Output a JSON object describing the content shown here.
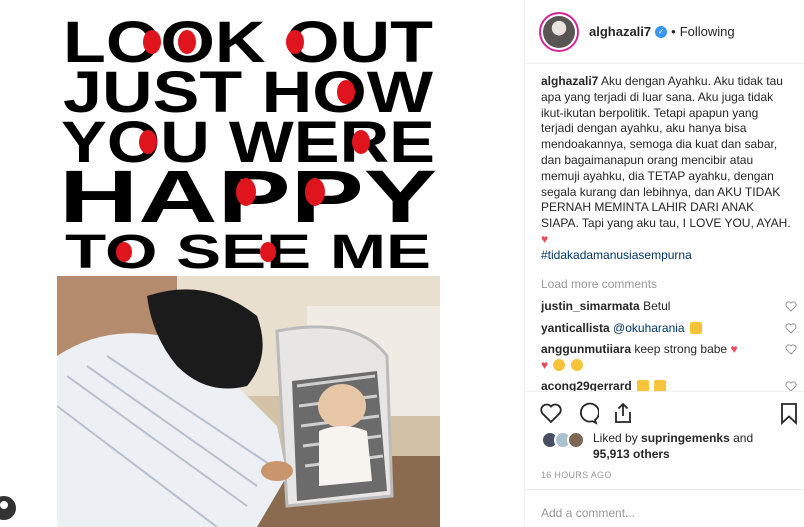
{
  "post_image": {
    "poster_lines": [
      "LOOK OUT",
      "JUST HOW",
      "YOU WERE",
      "HAPPY",
      "TO SEE ME"
    ]
  },
  "header": {
    "username": "alghazali7",
    "separator": "•",
    "follow_status": "Following"
  },
  "caption": {
    "username": "alghazali7",
    "text": "Aku dengan Ayahku. Aku tidak tau apa yang terjadi di luar sana. Aku juga tidak ikut-ikutan berpolitik. Tetapi apapun yang terjadi dengan ayahku, aku hanya bisa mendoakannya, semoga dia kuat dan sabar, dan bagaimanapun orang mencibir atau memuji ayahku, dia TETAP ayahku, dengan segala kurang dan lebihnya, dan AKU TIDAK PERNAH MEMINTA LAHIR DARI ANAK SIAPA. Tapi yang aku tau, I LOVE YOU, AYAH.",
    "emoji": "♥",
    "hashtag": "#tidakadamanusiasempurna"
  },
  "load_more": "Load more comments",
  "comments": [
    {
      "username": "justin_simarmata",
      "text": "Betul"
    },
    {
      "username": "yanticallista",
      "mention": "@okuharania"
    },
    {
      "username": "anggunmutiiara",
      "text": "keep strong babe"
    },
    {
      "username": "acong29gerrard",
      "text": ""
    }
  ],
  "likes": {
    "prefix": "Liked by",
    "user": "supringemenks",
    "joiner": "and",
    "count": "95,913 others"
  },
  "timestamp": "16 HOURS AGO",
  "add_comment": {
    "placeholder": "Add a comment..."
  },
  "colors": {
    "heart_red": "#ed4956",
    "link_blue": "#003569",
    "verified_blue": "#3897f0",
    "muted": "#999999"
  }
}
